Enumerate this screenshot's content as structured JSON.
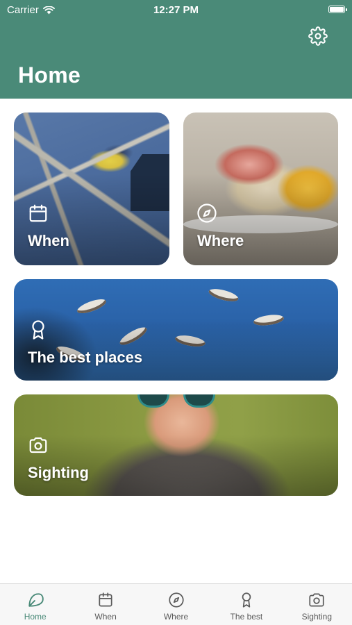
{
  "status_bar": {
    "carrier": "Carrier",
    "time": "12:27 PM"
  },
  "header": {
    "title": "Home",
    "settings_icon": "gear-icon"
  },
  "theme": {
    "accent": "#4a8a78",
    "tab_inactive": "#5a5a5a"
  },
  "cards": [
    {
      "id": "when",
      "label": "When",
      "icon": "calendar-icon"
    },
    {
      "id": "where",
      "label": "Where",
      "icon": "compass-icon"
    },
    {
      "id": "best-places",
      "label": "The best places",
      "icon": "award-icon"
    },
    {
      "id": "sighting",
      "label": "Sighting",
      "icon": "camera-icon"
    }
  ],
  "tab_bar": {
    "active": "Home",
    "items": [
      {
        "label": "Home",
        "icon": "leaf-icon"
      },
      {
        "label": "When",
        "icon": "calendar-icon"
      },
      {
        "label": "Where",
        "icon": "compass-icon"
      },
      {
        "label": "The best",
        "icon": "award-icon"
      },
      {
        "label": "Sighting",
        "icon": "camera-icon"
      }
    ]
  }
}
